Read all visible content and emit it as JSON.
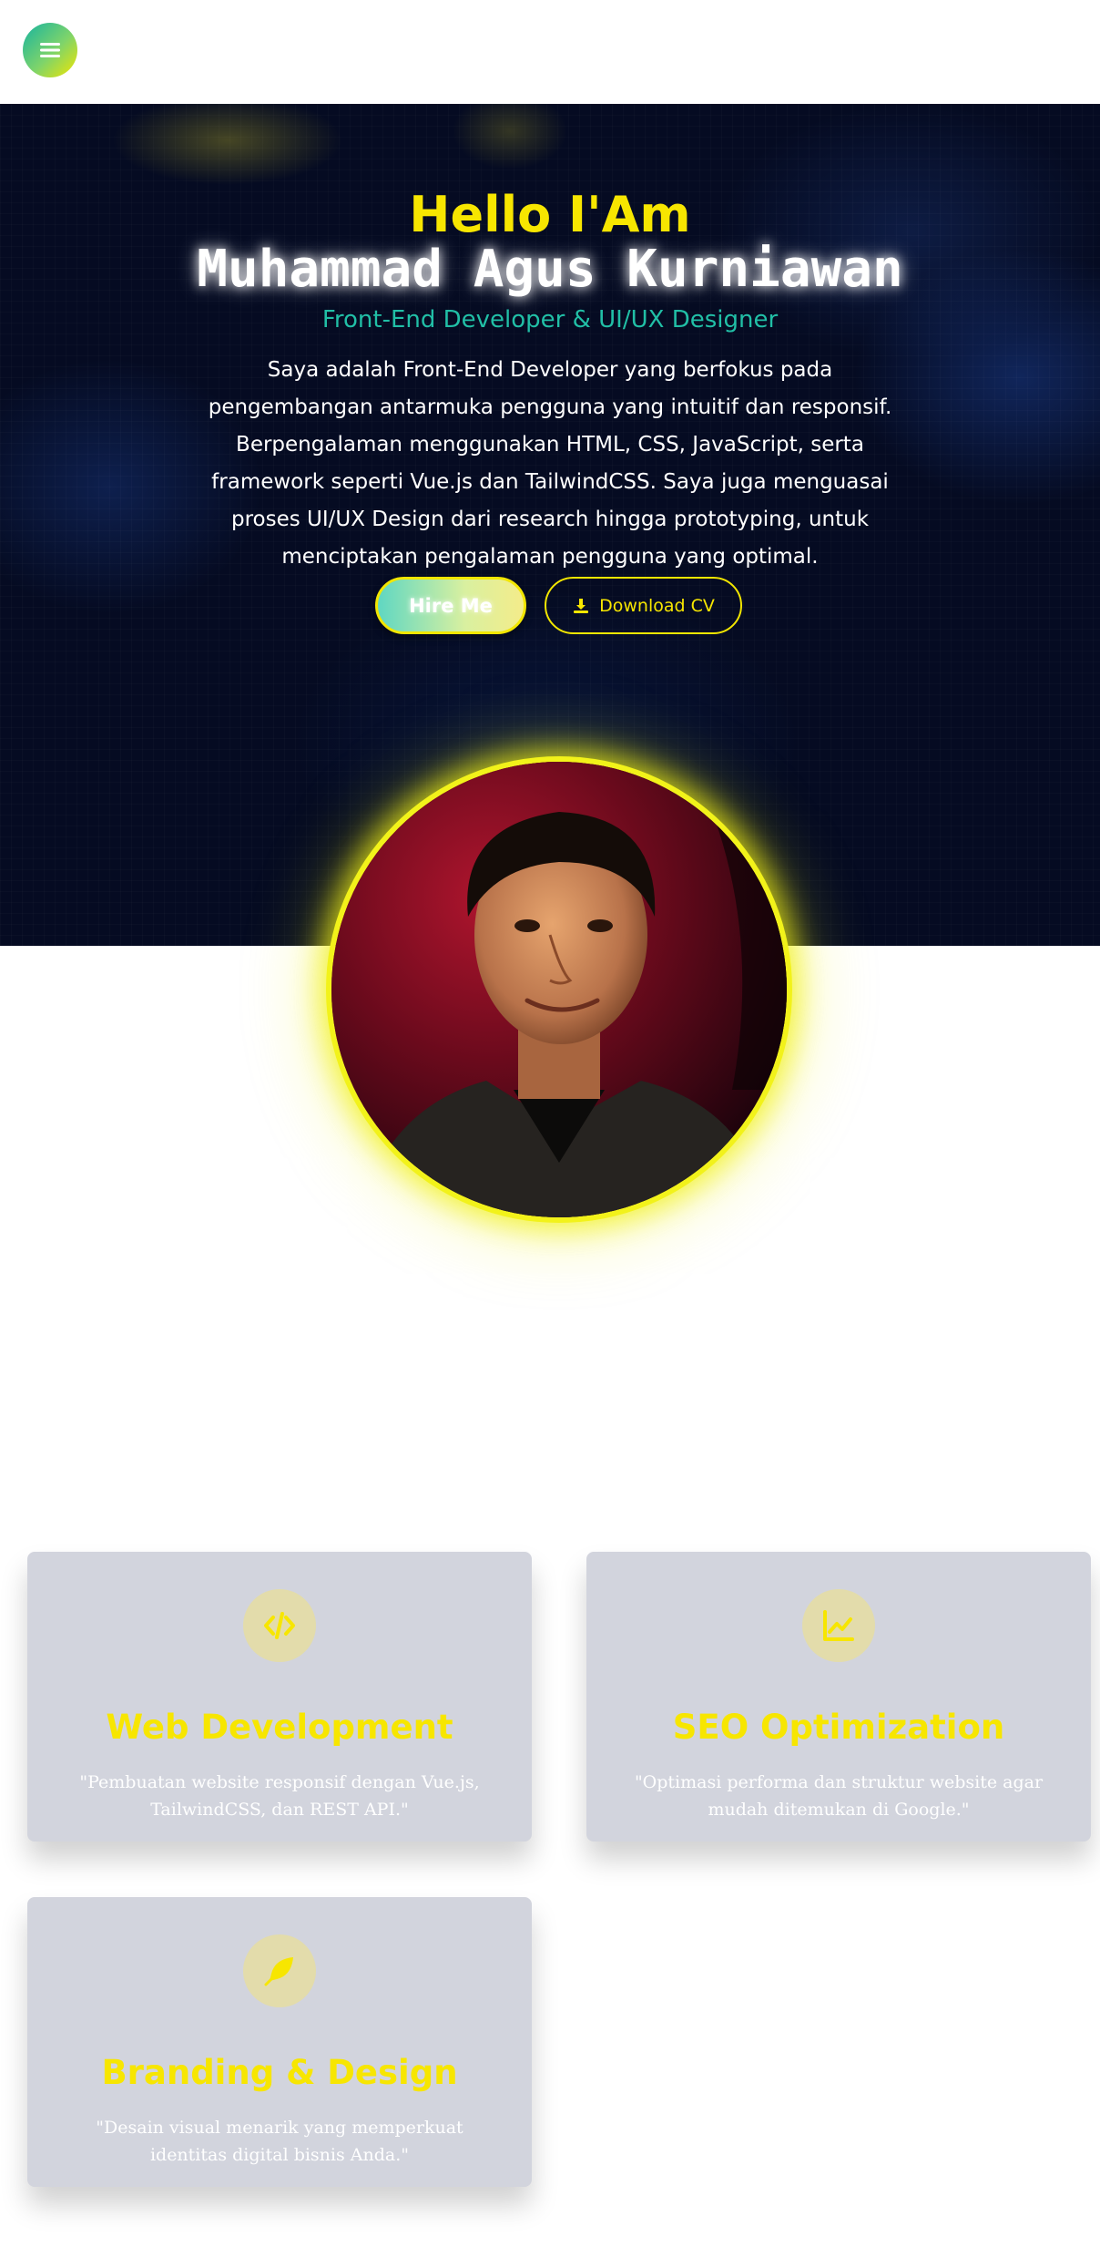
{
  "nav": {
    "menu_icon": "hamburger-menu-icon"
  },
  "hero": {
    "greeting": "Hello I'Am",
    "name": "Muhammad Agus Kurniawan",
    "role": "Front-End Developer & UI/UX Designer",
    "description": "Saya adalah Front-End Developer yang berfokus pada pengembangan antarmuka pengguna yang intuitif dan responsif. Berpengalaman menggunakan HTML, CSS, JavaScript, serta framework seperti Vue.js dan TailwindCSS. Saya juga menguasai proses UI/UX Design dari research hingga prototyping, untuk menciptakan pengalaman pengguna yang optimal.",
    "hire_label": "Hire Me",
    "cv_label": "Download CV",
    "cv_icon": "download-icon"
  },
  "services": [
    {
      "icon": "code-icon",
      "title": "Web Development",
      "text": "\"Pembuatan website responsif dengan Vue.js, TailwindCSS, dan REST API.\""
    },
    {
      "icon": "chart-line-icon",
      "title": "SEO Optimization",
      "text": "\"Optimasi performa dan struktur website agar mudah ditemukan di Google.\""
    },
    {
      "icon": "feather-icon",
      "title": "Branding & Design",
      "text": "\"Desain visual menarik yang memperkuat identitas digital bisnis Anda.\""
    }
  ],
  "colors": {
    "accent_yellow": "#f7e600",
    "accent_teal": "#21bfa6",
    "hero_bg": "#050b22",
    "card_bg": "#d2d4dd"
  }
}
